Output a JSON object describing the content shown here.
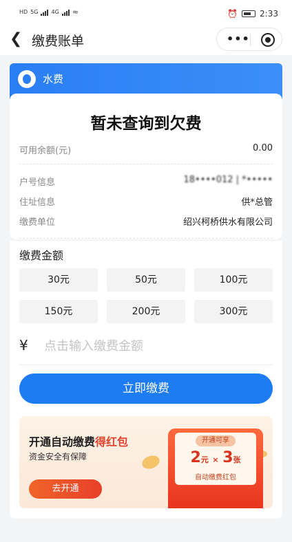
{
  "status_bar": {
    "left_labels": [
      "HD",
      "5G",
      "4G"
    ],
    "time": "2:33"
  },
  "nav": {
    "title": "缴费账单",
    "more_label": "•••"
  },
  "bill": {
    "category": "水费",
    "headline": "暂未查询到欠费",
    "balance_label": "可用余额(元)",
    "balance_value": "0.00",
    "account_label": "户号信息",
    "account_value": "18••••012 | *•••••",
    "address_label": "住址信息",
    "address_value": "供*总管",
    "unit_label": "缴费单位",
    "unit_value": "绍兴柯桥供水有限公司"
  },
  "payment": {
    "section_title": "缴费金额",
    "amounts": [
      "30元",
      "50元",
      "100元",
      "150元",
      "200元",
      "300元"
    ],
    "currency_symbol": "¥",
    "input_placeholder": "点击输入缴费金额",
    "pay_button": "立即缴费"
  },
  "promo": {
    "title_prefix": "开通自动缴费",
    "title_highlight": "得红包",
    "subtitle": "资金安全有保障",
    "open_button": "去开通",
    "tag": "开通可享",
    "amount_number": "2",
    "amount_unit": "元",
    "times_symbol": "×",
    "count_number": "3",
    "count_unit": "张",
    "caption": "自动缴费红包"
  },
  "colors": {
    "primary_blue": "#1d7cf2",
    "promo_red": "#e0432e"
  }
}
